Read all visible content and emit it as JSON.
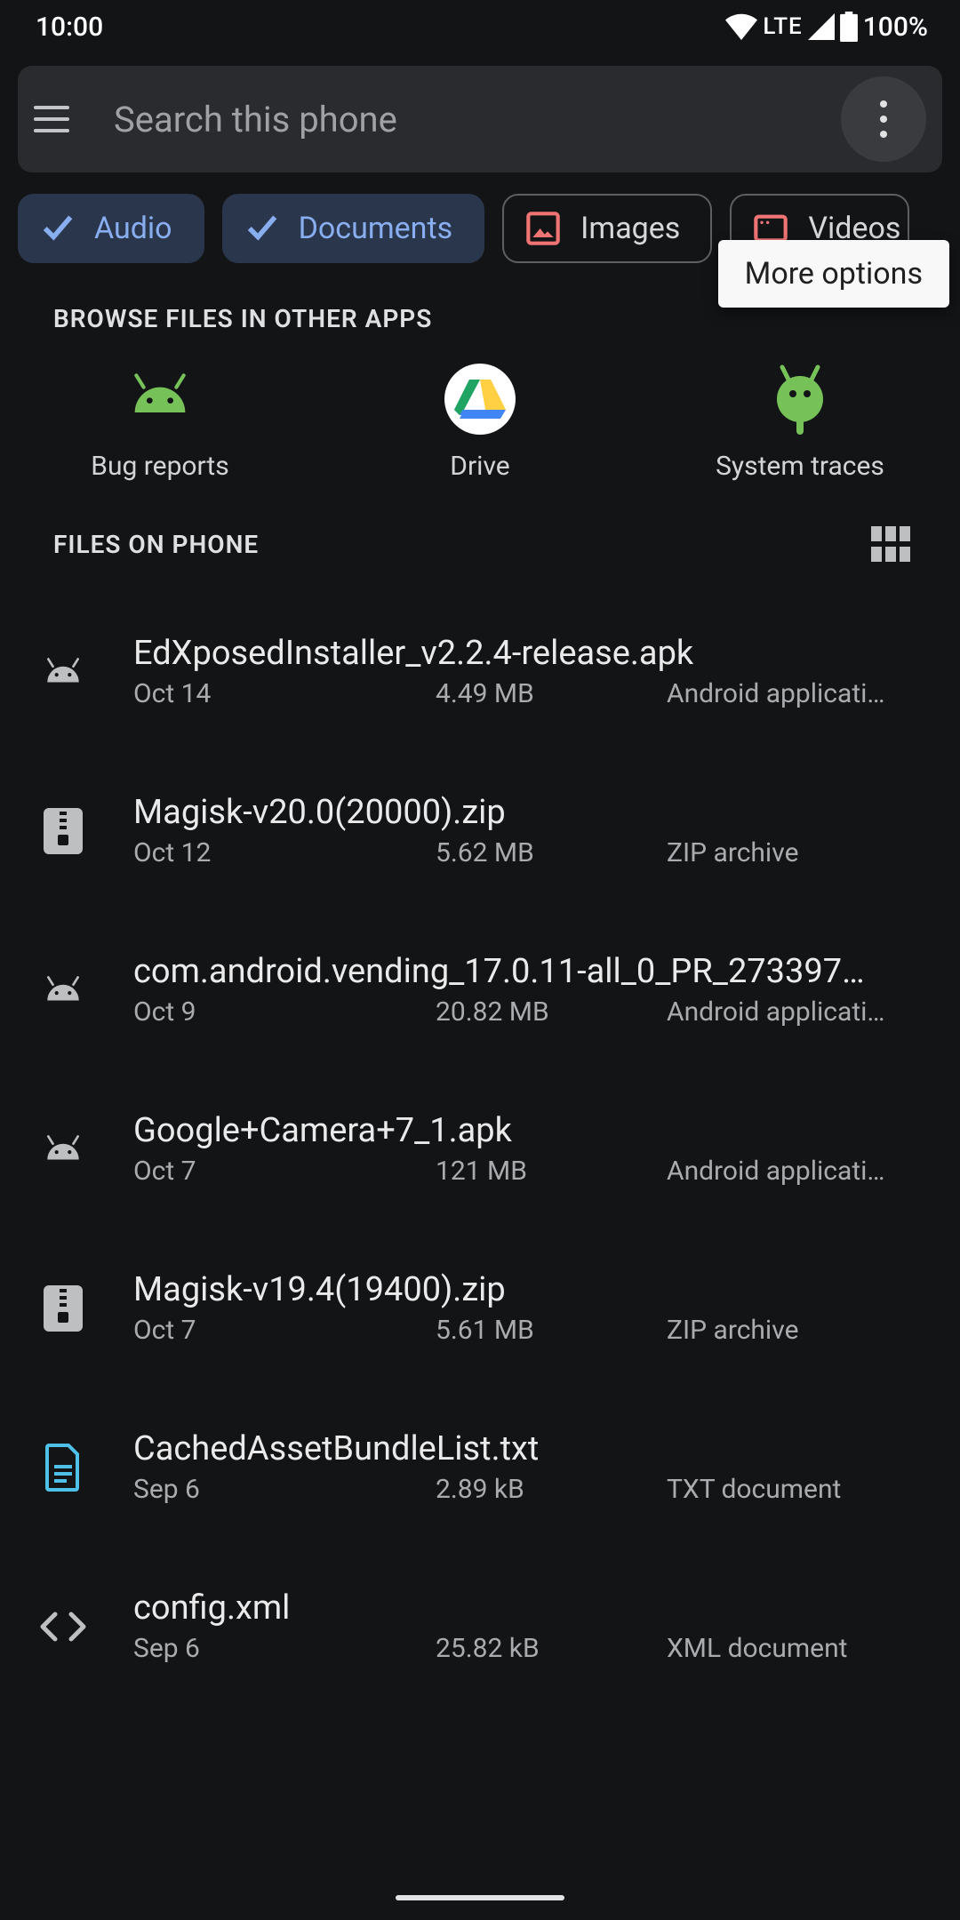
{
  "status_bar": {
    "time": "10:00",
    "network": "LTE",
    "battery": "100%"
  },
  "search": {
    "placeholder": "Search this phone"
  },
  "tooltip": "More options",
  "chips": [
    {
      "label": "Audio",
      "active": true
    },
    {
      "label": "Documents",
      "active": true
    },
    {
      "label": "Images",
      "active": false
    },
    {
      "label": "Videos",
      "active": false
    }
  ],
  "section_browse": "BROWSE FILES IN OTHER APPS",
  "other_apps": [
    {
      "label": "Bug reports",
      "icon": "bugdroid"
    },
    {
      "label": "Drive",
      "icon": "drive"
    },
    {
      "label": "System traces",
      "icon": "bugdroid-round"
    }
  ],
  "section_files": "FILES ON PHONE",
  "files": [
    {
      "name": "EdXposedInstaller_v2.2.4-release.apk",
      "date": "Oct 14",
      "size": "4.49 MB",
      "type": "Android applicati…",
      "icon": "apk"
    },
    {
      "name": "Magisk-v20.0(20000).zip",
      "date": "Oct 12",
      "size": "5.62 MB",
      "type": "ZIP archive",
      "icon": "zip"
    },
    {
      "name": "com.android.vending_17.0.11-all_0_PR_273397…",
      "date": "Oct 9",
      "size": "20.82 MB",
      "type": "Android applicati…",
      "icon": "apk"
    },
    {
      "name": "Google+Camera+7_1.apk",
      "date": "Oct 7",
      "size": "121 MB",
      "type": "Android applicati…",
      "icon": "apk"
    },
    {
      "name": "Magisk-v19.4(19400).zip",
      "date": "Oct 7",
      "size": "5.61 MB",
      "type": "ZIP archive",
      "icon": "zip"
    },
    {
      "name": "CachedAssetBundleList.txt",
      "date": "Sep 6",
      "size": "2.89 kB",
      "type": "TXT document",
      "icon": "txt"
    },
    {
      "name": "config.xml",
      "date": "Sep 6",
      "size": "25.82 kB",
      "type": "XML document",
      "icon": "xml"
    }
  ]
}
